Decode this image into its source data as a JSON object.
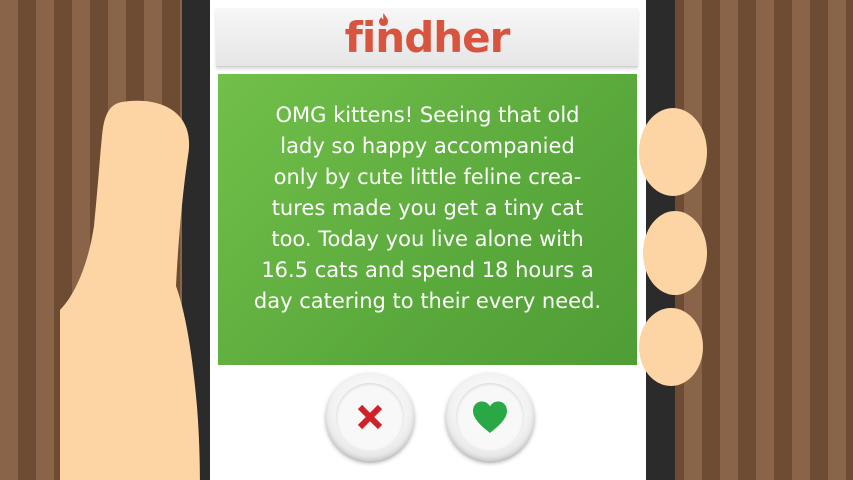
{
  "app": {
    "logo_text": "findher",
    "brand_color": "#d9543e"
  },
  "card": {
    "message": "OMG kittens! Seeing that old\nlady so happy accompanied\nonly by cute little feline crea-\ntures made you get a tiny cat\ntoo. Today you live alone with\n16.5 cats and spend 18 hours a\nday catering to their every need.",
    "background_color": "#62b043"
  },
  "actions": {
    "reject": {
      "icon": "x-icon",
      "color": "#d0202a"
    },
    "like": {
      "icon": "heart-icon",
      "color": "#2aa845"
    }
  }
}
